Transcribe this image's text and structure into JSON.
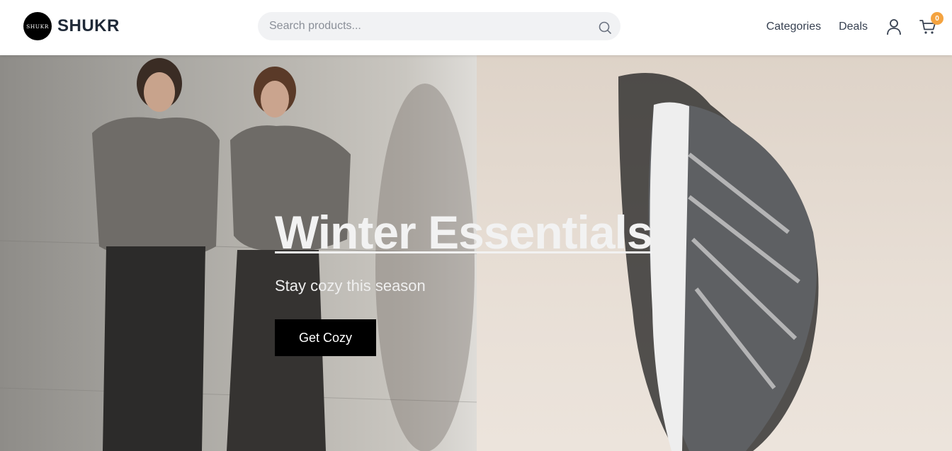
{
  "header": {
    "logo_text": "SHUKR",
    "brand_name": "SHUKR",
    "search": {
      "placeholder": "Search products...",
      "icon": "search-icon"
    },
    "nav": {
      "categories_label": "Categories",
      "deals_label": "Deals",
      "user_icon": "user-icon",
      "cart_icon": "cart-icon",
      "cart_count": "0"
    }
  },
  "hero": {
    "title": "Winter Essentials",
    "subtitle": "Stay cozy this season",
    "cta_label": "Get Cozy",
    "left_image": "hoodie-models-photo",
    "right_image": "sneaker-photo"
  },
  "colors": {
    "badge": "#f4a340",
    "cta_background": "#000000",
    "search_background": "#f1f2f4"
  }
}
